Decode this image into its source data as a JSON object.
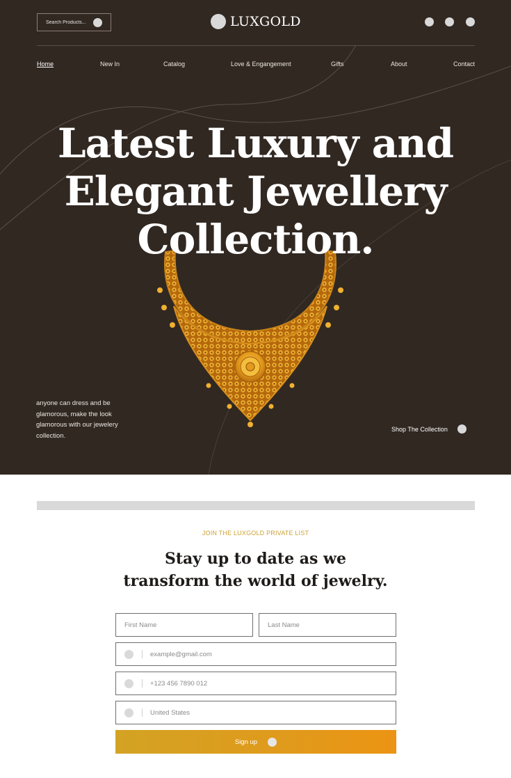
{
  "colors": {
    "hero_background": "#312822",
    "accent_gold": "#cda233",
    "button_gradient_start": "#d3a323",
    "button_gradient_end": "#ec9413",
    "icon_placeholder": "#d9d9d9"
  },
  "header": {
    "search_placeholder": "Search Products...",
    "search_icon": "search-icon",
    "logo_text": "LUXGOLD",
    "action_icons": [
      "wishlist-icon",
      "cart-icon",
      "account-icon"
    ]
  },
  "nav": {
    "items": [
      {
        "label": "Home",
        "active": true
      },
      {
        "label": "New In"
      },
      {
        "label": "Catalog"
      },
      {
        "label": "Love & Engangement"
      },
      {
        "label": "Gifts"
      },
      {
        "label": "About"
      },
      {
        "label": "Contact"
      }
    ]
  },
  "hero": {
    "headline": [
      "Latest Luxury and",
      "Elegant Jewellery",
      "Collection."
    ],
    "description": "anyone can dress and be glamorous, make the look glamorous with our jewelery collection.",
    "cta_label": "Shop The Collection",
    "cta_icon": "arrow-icon"
  },
  "newsletter": {
    "eyebrow": "JOIN THE LUXGOLD PRIVATE LIST",
    "title": [
      "Stay up to date as we",
      "transform the world of jewelry."
    ],
    "first_name_placeholder": "First Name",
    "last_name_placeholder": "Last Name",
    "email_placeholder": "example@gmail.com",
    "phone_placeholder": "+123 456 7890 012",
    "country_value": "United States",
    "email_icon": "mail-icon",
    "phone_icon": "phone-icon",
    "country_icon": "flag-icon",
    "submit_label": "Sign up",
    "submit_icon": "arrow-icon"
  }
}
